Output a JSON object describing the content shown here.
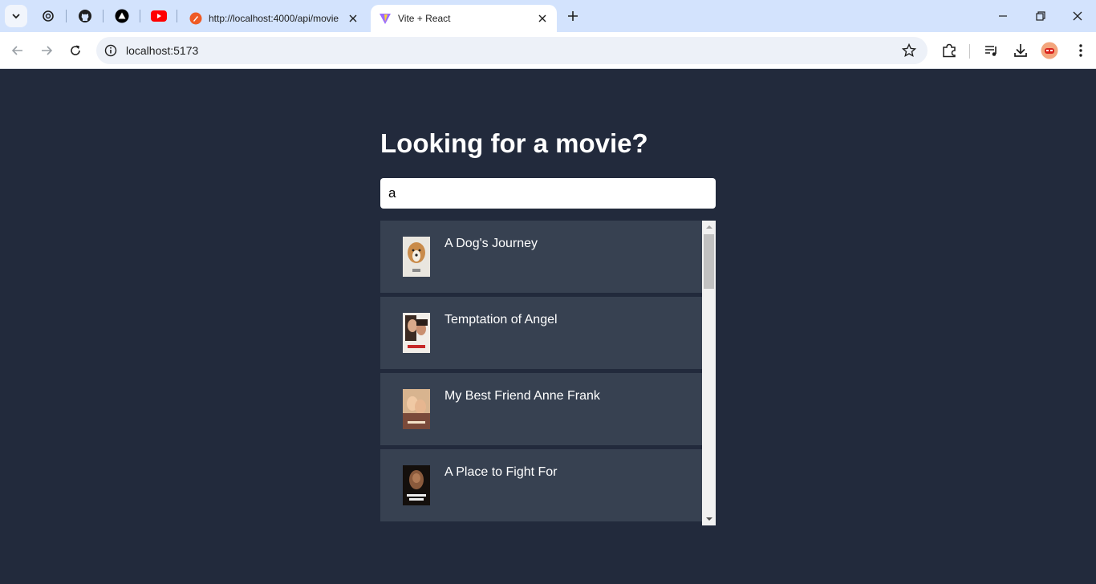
{
  "browser": {
    "tabs": [
      {
        "title": "http://localhost:4000/api/movie",
        "active": false
      },
      {
        "title": "Vite + React",
        "active": true
      }
    ],
    "address": "localhost:5173"
  },
  "page": {
    "heading": "Looking for a movie?",
    "search_value": "a",
    "movies": [
      {
        "title": "A Dog's Journey"
      },
      {
        "title": "Temptation of Angel"
      },
      {
        "title": "My Best Friend Anne Frank"
      },
      {
        "title": "A Place to Fight For"
      }
    ]
  },
  "colors": {
    "page_bg": "#222a3c",
    "card_bg": "#374151",
    "tabstrip_bg": "#d3e3fd"
  }
}
